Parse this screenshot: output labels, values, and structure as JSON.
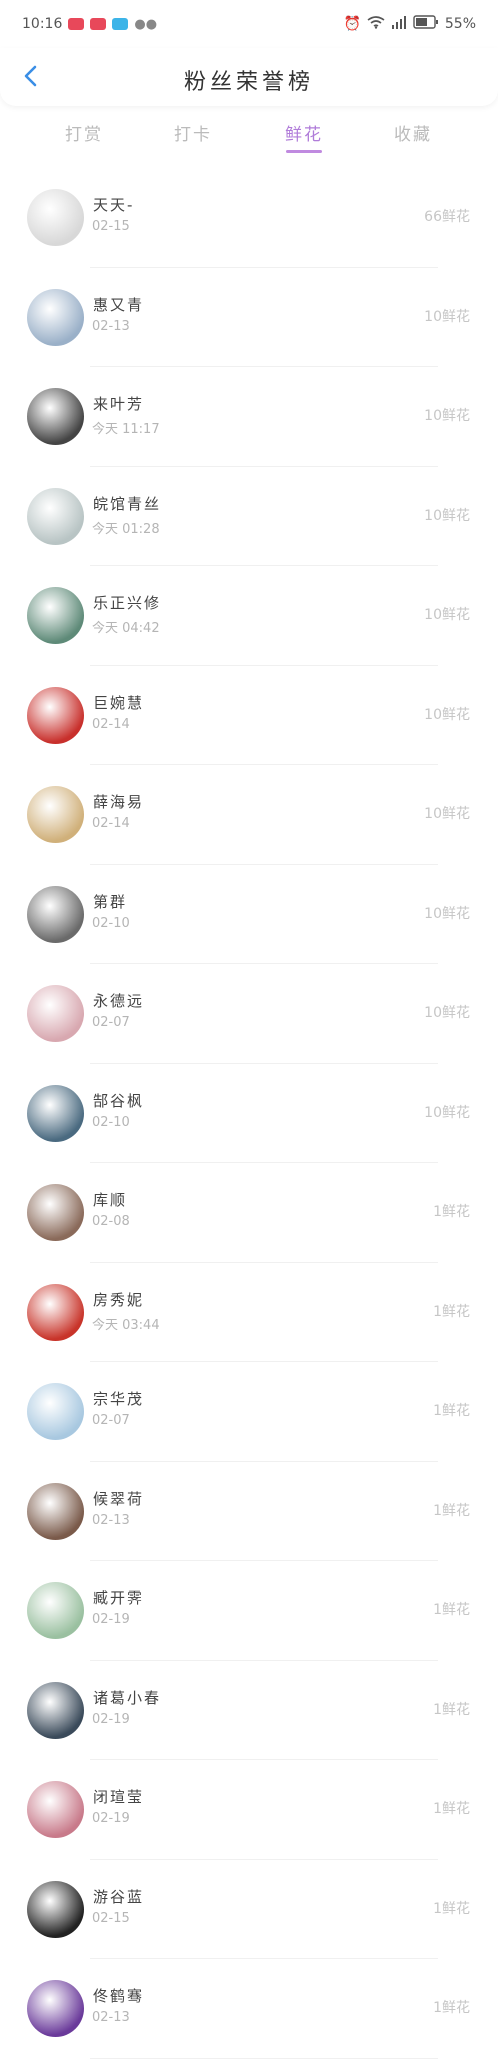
{
  "status_bar": {
    "time": "10:16",
    "battery": "55%"
  },
  "header": {
    "title": "粉丝荣誉榜"
  },
  "tabs": [
    {
      "label": "打赏"
    },
    {
      "label": "打卡"
    },
    {
      "label": "鲜花"
    },
    {
      "label": "收藏"
    }
  ],
  "active_tab": 2,
  "rows": [
    {
      "name": "天天-",
      "time": "02-15",
      "amount": "66鲜花",
      "avatar_color": "#d8d8d8"
    },
    {
      "name": "惠又青",
      "time": "02-13",
      "amount": "10鲜花",
      "avatar_color": "#9ab0c8"
    },
    {
      "name": "来叶芳",
      "time": "今天 11:17",
      "amount": "10鲜花",
      "avatar_color": "#444444"
    },
    {
      "name": "皖馆青丝",
      "time": "今天 01:28",
      "amount": "10鲜花",
      "avatar_color": "#b8c4c4"
    },
    {
      "name": "乐正兴修",
      "time": "今天 04:42",
      "amount": "10鲜花",
      "avatar_color": "#5e8a78"
    },
    {
      "name": "巨婉慧",
      "time": "02-14",
      "amount": "10鲜花",
      "avatar_color": "#c8302c"
    },
    {
      "name": "薛海易",
      "time": "02-14",
      "amount": "10鲜花",
      "avatar_color": "#d0b07a"
    },
    {
      "name": "第群",
      "time": "02-10",
      "amount": "10鲜花",
      "avatar_color": "#6a6a6a"
    },
    {
      "name": "永德远",
      "time": "02-07",
      "amount": "10鲜花",
      "avatar_color": "#d8a8b0"
    },
    {
      "name": "郜谷枫",
      "time": "02-10",
      "amount": "10鲜花",
      "avatar_color": "#4a6a80"
    },
    {
      "name": "库顺",
      "time": "02-08",
      "amount": "1鲜花",
      "avatar_color": "#8a6a5a"
    },
    {
      "name": "房秀妮",
      "time": "今天 03:44",
      "amount": "1鲜花",
      "avatar_color": "#c8342a"
    },
    {
      "name": "宗华茂",
      "time": "02-07",
      "amount": "1鲜花",
      "avatar_color": "#a8c8e0"
    },
    {
      "name": "候翠荷",
      "time": "02-13",
      "amount": "1鲜花",
      "avatar_color": "#7a5a4a"
    },
    {
      "name": "臧开霁",
      "time": "02-19",
      "amount": "1鲜花",
      "avatar_color": "#9ac0a0"
    },
    {
      "name": "诸葛小春",
      "time": "02-19",
      "amount": "1鲜花",
      "avatar_color": "#3a4a5a"
    },
    {
      "name": "闭瑄莹",
      "time": "02-19",
      "amount": "1鲜花",
      "avatar_color": "#c87a8a"
    },
    {
      "name": "游谷蓝",
      "time": "02-15",
      "amount": "1鲜花",
      "avatar_color": "#222222"
    },
    {
      "name": "佟鹤骞",
      "time": "02-13",
      "amount": "1鲜花",
      "avatar_color": "#6a3a9a"
    }
  ]
}
